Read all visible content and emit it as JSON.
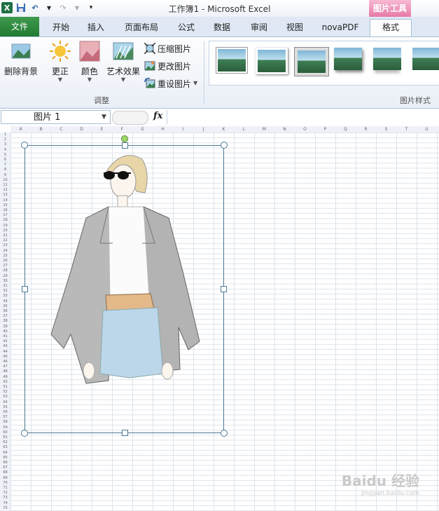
{
  "window": {
    "title": "工作簿1 - Microsoft Excel",
    "context_group": "图片工具"
  },
  "tabs": [
    "文件",
    "开始",
    "插入",
    "页面布局",
    "公式",
    "数据",
    "审阅",
    "视图",
    "novaPDF",
    "格式"
  ],
  "ribbon": {
    "remove_bg": "删除背景",
    "corrections": "更正",
    "color": "颜色",
    "artistic": "艺术效果",
    "compress": "压缩图片",
    "change": "更改图片",
    "reset": "重设图片",
    "adjust_group": "调整",
    "styles_group": "图片样式"
  },
  "formula_bar": {
    "name_box": "图片 1",
    "fx": "fx",
    "formula": ""
  },
  "columns": [
    "A",
    "B",
    "C",
    "D",
    "E",
    "F",
    "G",
    "H",
    "I",
    "J",
    "K",
    "L",
    "M",
    "N",
    "O",
    "P",
    "Q",
    "R",
    "S",
    "T",
    "U"
  ],
  "rows": [
    "1",
    "2",
    "3",
    "4",
    "5",
    "6",
    "7",
    "8",
    "9",
    "10",
    "11",
    "12",
    "13",
    "14",
    "15",
    "16",
    "17",
    "18",
    "19",
    "20",
    "21",
    "22",
    "23",
    "24",
    "25",
    "26",
    "27",
    "28",
    "29",
    "30",
    "31",
    "32",
    "33",
    "34",
    "35",
    "36",
    "37",
    "38",
    "39",
    "40",
    "41",
    "42",
    "43",
    "44",
    "45",
    "46",
    "47",
    "48",
    "49",
    "50",
    "51",
    "52",
    "53",
    "54",
    "55",
    "56",
    "57",
    "58",
    "59",
    "60",
    "61",
    "62",
    "63",
    "64",
    "65",
    "66",
    "67",
    "68",
    "69",
    "70",
    "71",
    "72",
    "73",
    "74",
    "75"
  ],
  "watermark": {
    "text": "Baidu 经验",
    "sub": "jingyan.baidu.com"
  },
  "colors": {
    "file_tab": "#1f7a31",
    "context_tab": "#e77aa8",
    "selection": "#4e7894"
  }
}
